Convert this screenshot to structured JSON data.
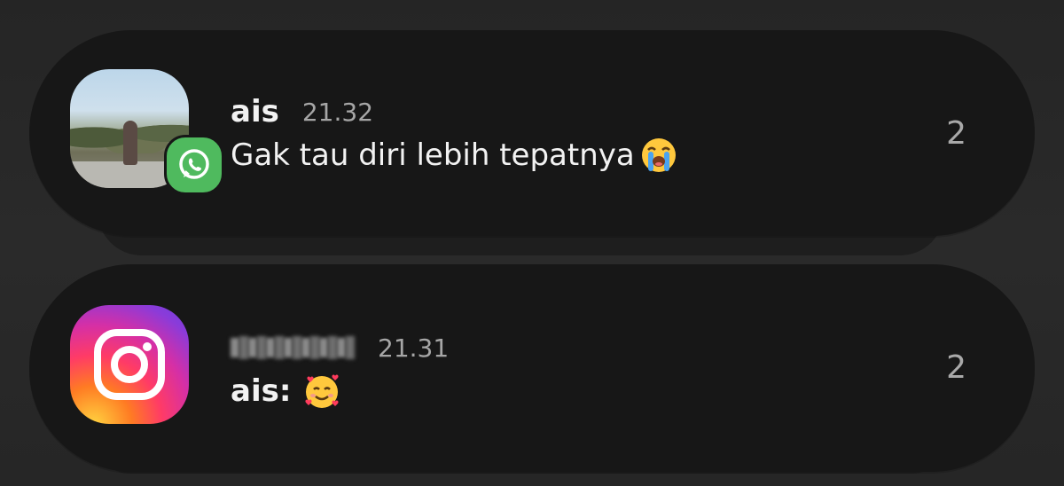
{
  "notifications": [
    {
      "app": "WhatsApp",
      "app_icon": "whatsapp-icon",
      "sender": "ais",
      "time": "21.32",
      "message": "Gak tau diri lebih tepatnya",
      "emoji": "loudly-crying-face-emoji",
      "count": "2"
    },
    {
      "app": "Instagram",
      "app_icon": "instagram-icon",
      "sender": "",
      "sender_blurred": true,
      "time": "21.31",
      "message_prefix": "ais:",
      "emoji": "smiling-face-with-hearts-emoji",
      "count": "2"
    }
  ],
  "colors": {
    "background": "#262626",
    "card": "#171717",
    "whatsapp_green": "#4fba5e",
    "primary_text": "#f2f2f2",
    "secondary_text": "#a6a6a6"
  }
}
